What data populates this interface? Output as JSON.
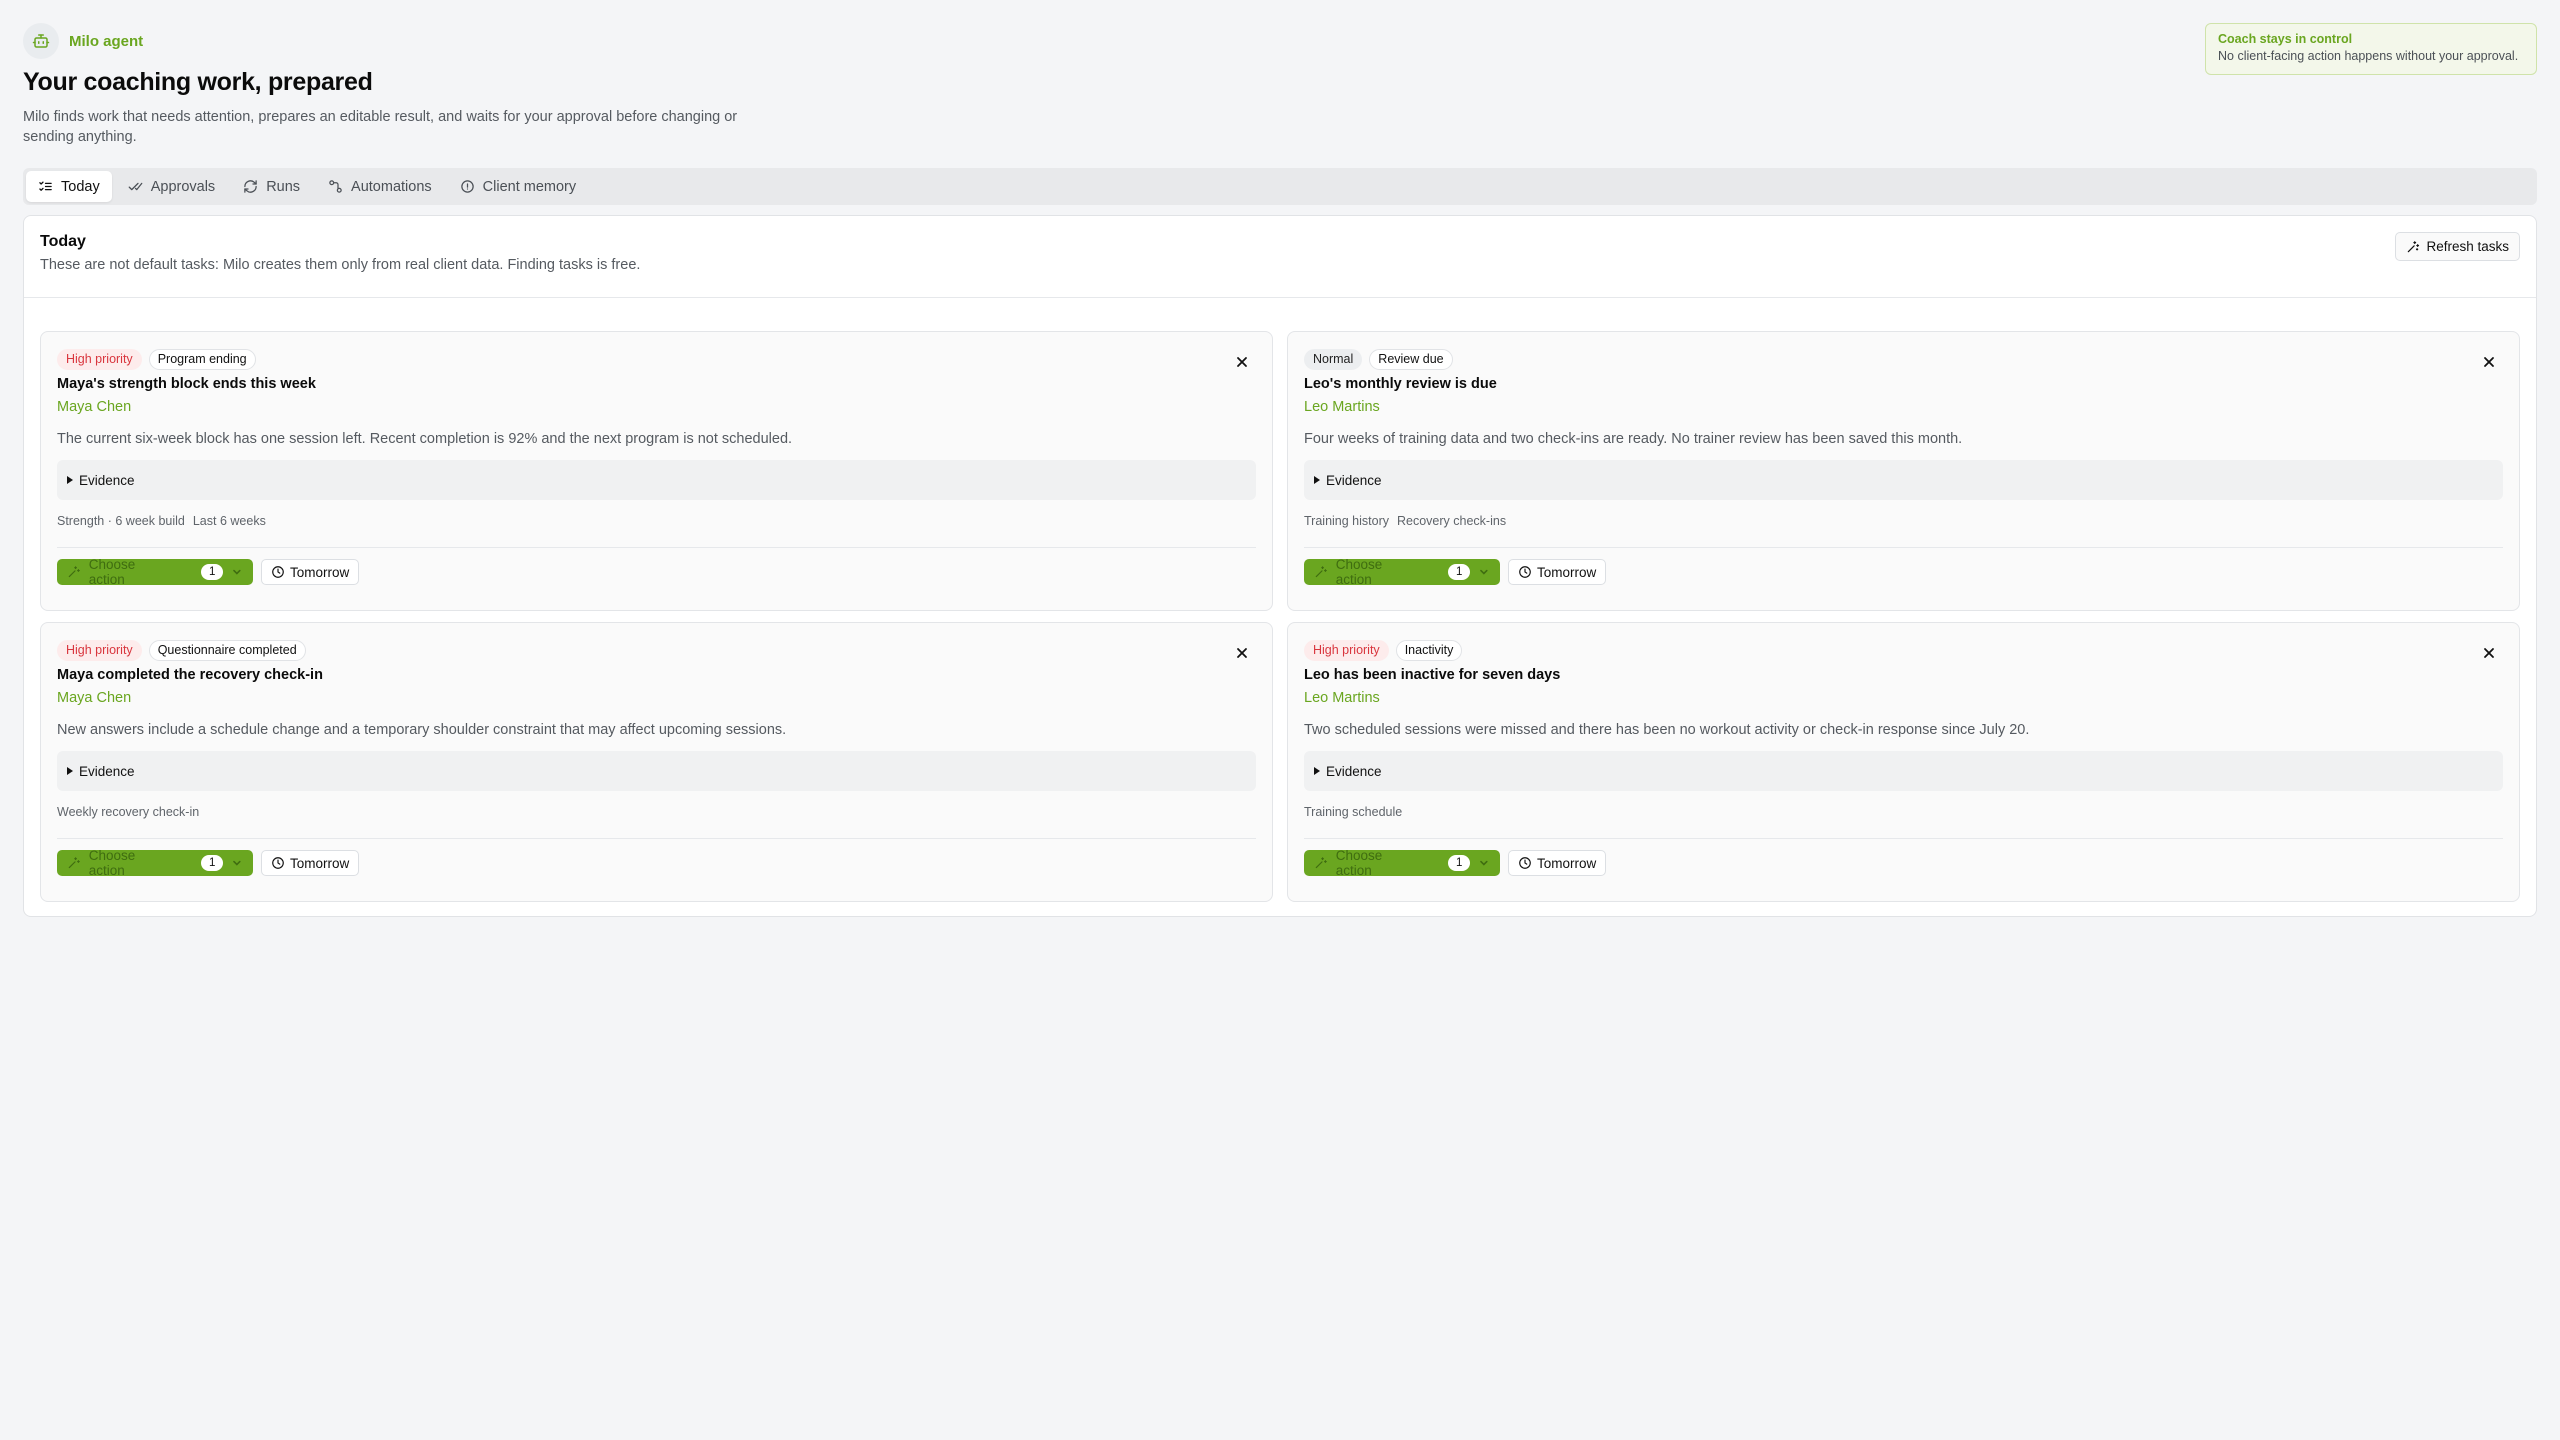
{
  "agent": {
    "name": "Milo agent",
    "icon": "robot-icon"
  },
  "header": {
    "title": "Your coaching work, prepared",
    "subtitle": "Milo finds work that needs attention, prepares an editable result, and waits for your approval before changing or sending anything."
  },
  "control_notice": {
    "title": "Coach stays in control",
    "text": "No client-facing action happens without your approval."
  },
  "tabs": [
    {
      "label": "Today",
      "icon": "list-checks-icon",
      "active": true
    },
    {
      "label": "Approvals",
      "icon": "check-double-icon",
      "active": false
    },
    {
      "label": "Runs",
      "icon": "refresh-icon",
      "active": false
    },
    {
      "label": "Automations",
      "icon": "workflow-icon",
      "active": false
    },
    {
      "label": "Client memory",
      "icon": "info-icon",
      "active": false
    }
  ],
  "panel": {
    "title": "Today",
    "subtitle": "These are not default tasks: Milo creates them only from real client data. Finding tasks is free.",
    "refresh_label": "Refresh tasks"
  },
  "cards": [
    {
      "priority": "High priority",
      "tag": "Program ending",
      "title": "Maya's strength block ends this week",
      "client": "Maya Chen",
      "description": "The current six-week block has one session left. Recent completion is 92% and the next program is not scheduled.",
      "evidence_label": "Evidence",
      "sources": [
        "Strength · 6 week build",
        "Last 6 weeks"
      ],
      "action_label": "Choose action",
      "action_count": "1",
      "snooze_label": "Tomorrow"
    },
    {
      "priority": "Normal",
      "tag": "Review due",
      "title": "Leo's monthly review is due",
      "client": "Leo Martins",
      "description": "Four weeks of training data and two check-ins are ready. No trainer review has been saved this month.",
      "evidence_label": "Evidence",
      "sources": [
        "Training history",
        "Recovery check-ins"
      ],
      "action_label": "Choose action",
      "action_count": "1",
      "snooze_label": "Tomorrow"
    },
    {
      "priority": "High priority",
      "tag": "Questionnaire completed",
      "title": "Maya completed the recovery check-in",
      "client": "Maya Chen",
      "description": "New answers include a schedule change and a temporary shoulder constraint that may affect upcoming sessions.",
      "evidence_label": "Evidence",
      "sources": [
        "Weekly recovery check-in"
      ],
      "action_label": "Choose action",
      "action_count": "1",
      "snooze_label": "Tomorrow"
    },
    {
      "priority": "High priority",
      "tag": "Inactivity",
      "title": "Leo has been inactive for seven days",
      "client": "Leo Martins",
      "description": "Two scheduled sessions were missed and there has been no workout activity or check-in response since July 20.",
      "evidence_label": "Evidence",
      "sources": [
        "Training schedule"
      ],
      "action_label": "Choose action",
      "action_count": "1",
      "snooze_label": "Tomorrow"
    }
  ],
  "colors": {
    "accent": "#6aa620",
    "high_priority_bg": "#fdecec",
    "high_priority_text": "#d9363e",
    "page_bg": "#f4f5f7"
  }
}
